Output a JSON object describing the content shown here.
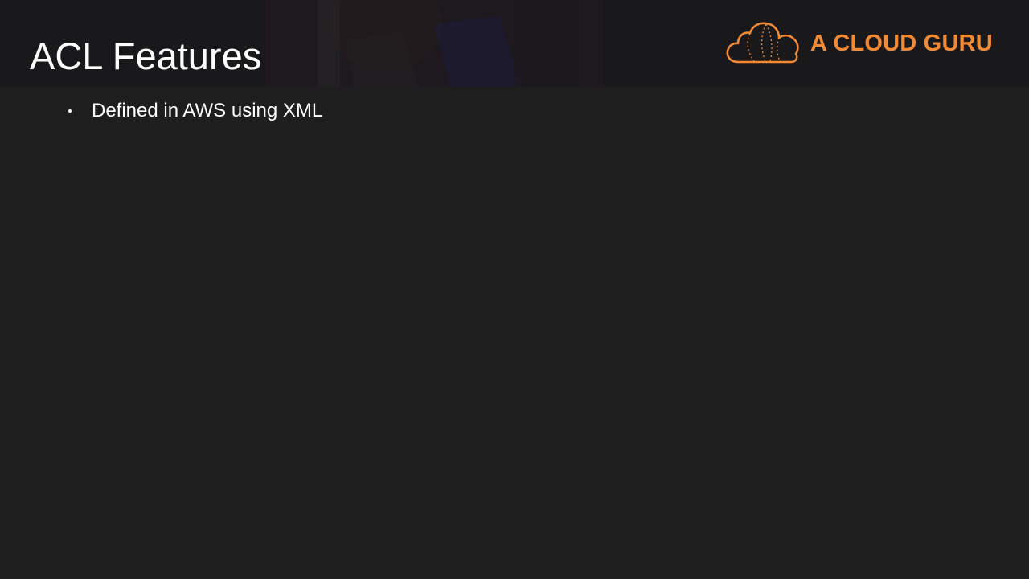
{
  "slide": {
    "title": "ACL Features",
    "bullets": [
      "Defined in AWS using XML"
    ]
  },
  "logo": {
    "text": "A CLOUD GURU",
    "icon": "cloud-logo-icon",
    "color": "#f28a35"
  },
  "colors": {
    "background": "#1e1e1e",
    "title_text": "#ffffff",
    "body_text": "#ffffff"
  }
}
